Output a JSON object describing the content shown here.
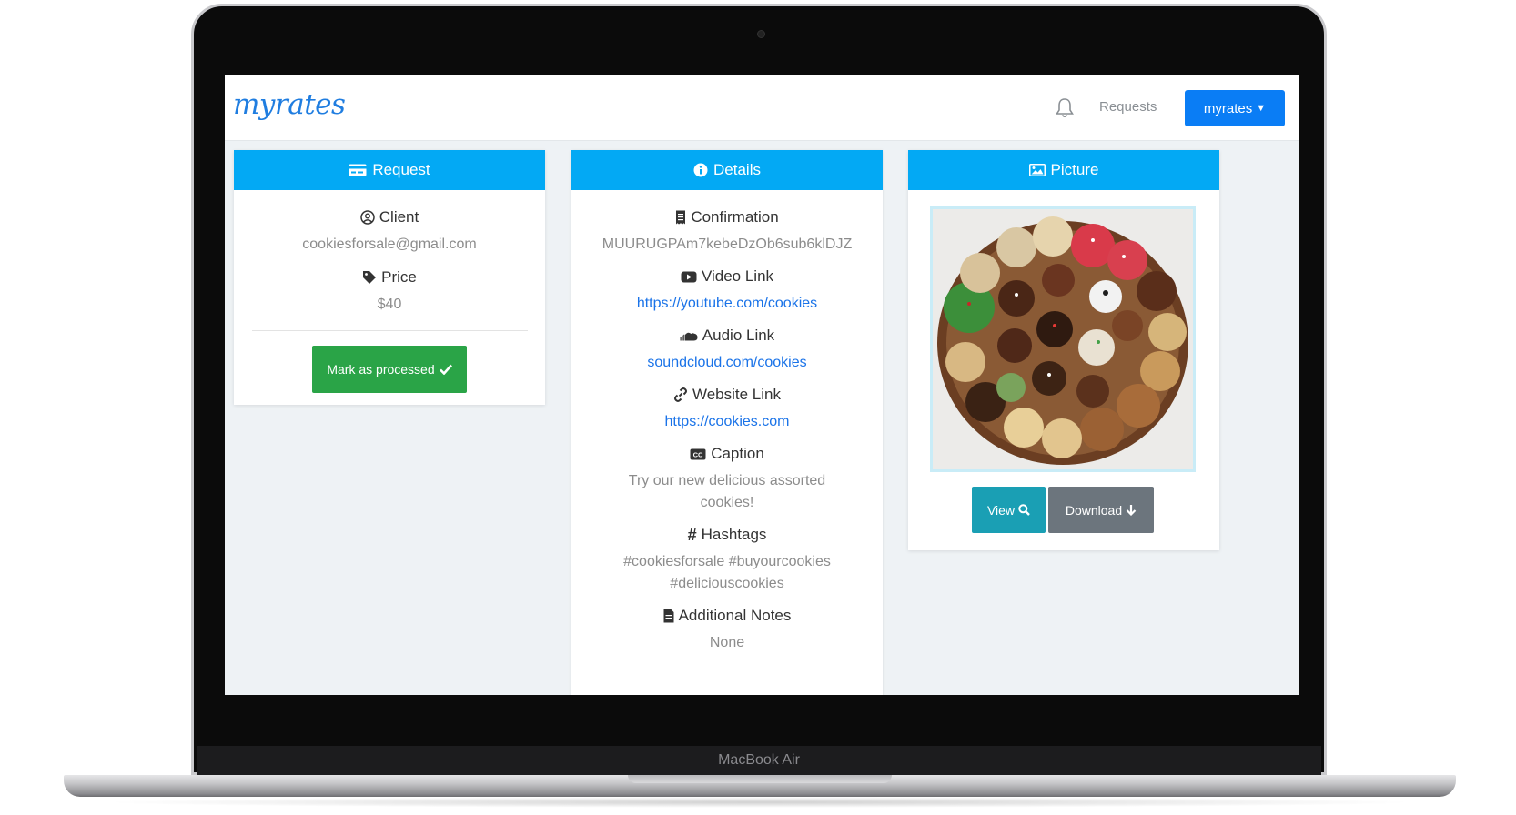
{
  "device": {
    "brand_label": "MacBook Air"
  },
  "navbar": {
    "logo": "myrates",
    "bell_icon": "bell-icon",
    "requests_link": "Requests",
    "user_menu": "myrates",
    "user_menu_icon": "chevron-down-icon"
  },
  "request_card": {
    "title": "Request",
    "icon": "credit-card-icon",
    "client_label": "Client",
    "client_icon": "user-circle-icon",
    "client_value": "cookiesforsale@gmail.com",
    "price_label": "Price",
    "price_icon": "tag-icon",
    "price_value": "$40",
    "mark_button": "Mark as processed",
    "mark_button_icon": "check-icon"
  },
  "details_card": {
    "title": "Details",
    "icon": "info-circle-icon",
    "fields": [
      {
        "label": "Confirmation",
        "icon": "receipt-icon",
        "value": "MUURUGPAm7kebeDzOb6sub6klDJZ",
        "link": false
      },
      {
        "label": "Video Link",
        "icon": "youtube-icon",
        "value": "https://youtube.com/cookies",
        "link": true
      },
      {
        "label": "Audio Link",
        "icon": "soundcloud-icon",
        "value": "soundcloud.com/cookies",
        "link": true
      },
      {
        "label": "Website Link",
        "icon": "link-icon",
        "value": "https://cookies.com",
        "link": true
      },
      {
        "label": "Caption",
        "icon": "closed-captions-icon",
        "value": "Try our new delicious assorted cookies!",
        "link": false
      },
      {
        "label": "Hashtags",
        "icon": "hashtag-icon",
        "value": "#cookiesforsale #buyourcookies #deliciouscookies",
        "link": false
      },
      {
        "label": "Additional Notes",
        "icon": "file-icon",
        "value": "None",
        "link": false
      }
    ]
  },
  "picture_card": {
    "title": "Picture",
    "icon": "image-icon",
    "photo": "cookie-platter-photo",
    "view_button": "View",
    "view_icon": "search-icon",
    "download_button": "Download",
    "download_icon": "arrow-down-icon"
  },
  "colors": {
    "header_blue": "#03a9f4",
    "primary_button": "#0a7df5",
    "success_button": "#2aa447",
    "info_button": "#1a9fb4",
    "secondary_button": "#6c757d",
    "link": "#1a73e8",
    "screen_bg": "#eef2f5"
  }
}
